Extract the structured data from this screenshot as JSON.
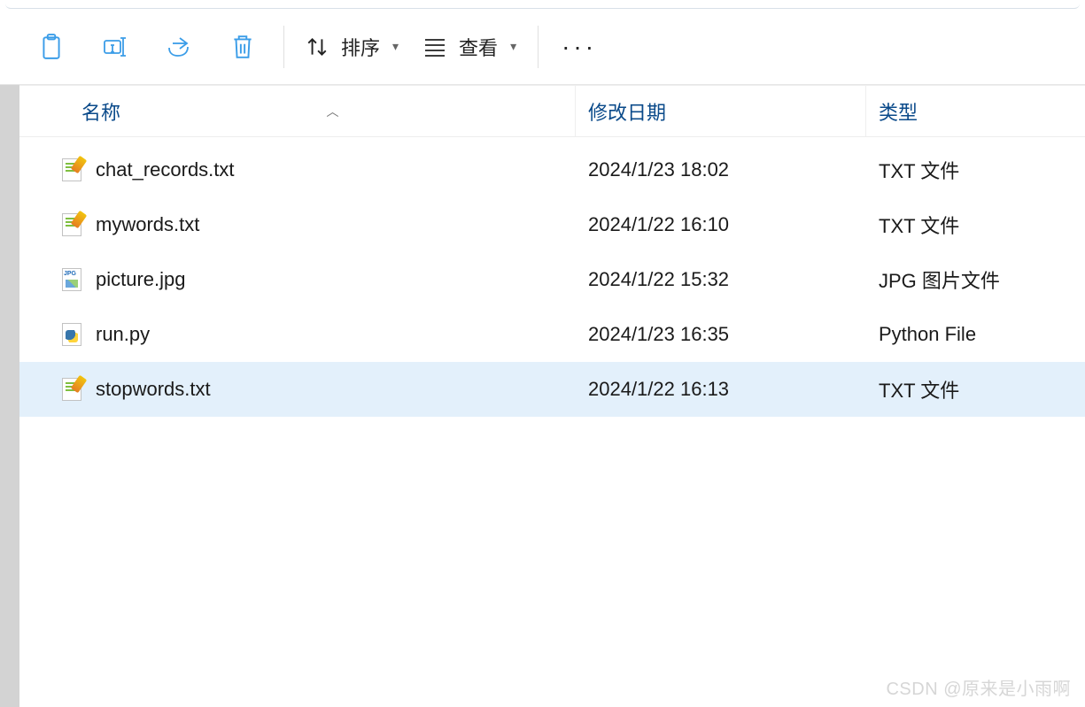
{
  "toolbar": {
    "sort_label": "排序",
    "view_label": "查看"
  },
  "columns": {
    "name": "名称",
    "date_modified": "修改日期",
    "type": "类型"
  },
  "files": [
    {
      "name": "chat_records.txt",
      "date": "2024/1/23 18:02",
      "type": "TXT 文件",
      "icon": "txt",
      "selected": false
    },
    {
      "name": "mywords.txt",
      "date": "2024/1/22 16:10",
      "type": "TXT 文件",
      "icon": "txt",
      "selected": false
    },
    {
      "name": "picture.jpg",
      "date": "2024/1/22 15:32",
      "type": "JPG 图片文件",
      "icon": "jpg",
      "selected": false
    },
    {
      "name": "run.py",
      "date": "2024/1/23 16:35",
      "type": "Python File",
      "icon": "py",
      "selected": false
    },
    {
      "name": "stopwords.txt",
      "date": "2024/1/22 16:13",
      "type": "TXT 文件",
      "icon": "txt",
      "selected": true
    }
  ],
  "watermark": "CSDN @原来是小雨啊"
}
